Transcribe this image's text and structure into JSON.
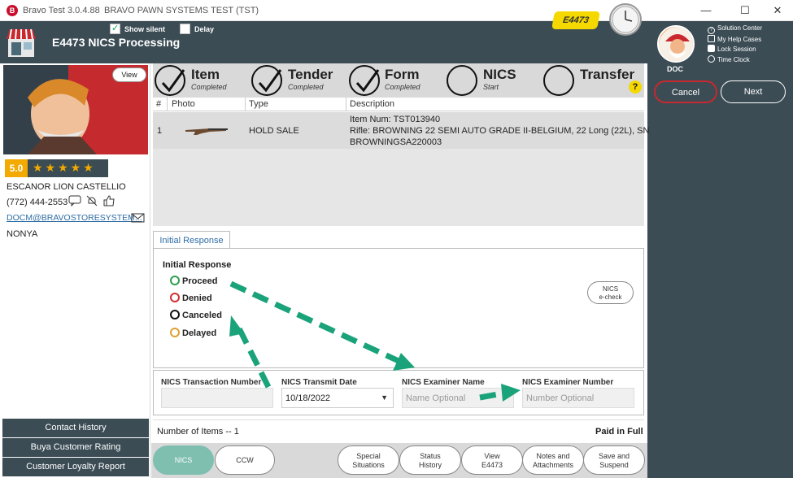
{
  "window": {
    "app_name": "Bravo Test",
    "version": "3.0.4.88",
    "system_name": "BRAVO PAWN SYSTEMS TEST (TST)",
    "minimize": "—",
    "maximize": "☐",
    "close": "✕"
  },
  "header": {
    "title": "E4473 NICS Processing",
    "show_silent_label": "Show silent",
    "show_silent_checked": true,
    "delay_label": "Delay",
    "delay_checked": false,
    "badge": "E4473"
  },
  "user_panel": {
    "name": "DOC",
    "links": [
      "Solution Center",
      "My Help Cases",
      "Lock Session",
      "Time Clock"
    ],
    "cancel_label": "Cancel",
    "next_label": "Next"
  },
  "customer": {
    "view_label": "View",
    "rating": "5.0",
    "stars": "★★★★★",
    "name": "ESCANOR LION CASTELLIO",
    "phone": "(772) 444-2553",
    "email": "DOCM@BRAVOSTORESYSTEM...",
    "note": "NONYA",
    "nav": [
      "Contact History",
      "Buya Customer Rating",
      "Customer Loyalty Report"
    ]
  },
  "steps": [
    {
      "title": "Item",
      "status": "Completed",
      "done": true
    },
    {
      "title": "Tender",
      "status": "Completed",
      "done": true
    },
    {
      "title": "Form",
      "status": "Completed",
      "done": true
    },
    {
      "title": "NICS",
      "status": "Start",
      "done": false
    },
    {
      "title": "Transfer",
      "status": "",
      "done": false
    }
  ],
  "help_icon": "?",
  "table": {
    "columns": [
      "#",
      "Photo",
      "Type",
      "Description"
    ],
    "rows": [
      {
        "num": "1",
        "type": "HOLD SALE",
        "desc_line1": "Item Num: TST013940",
        "desc_line2": "Rifle: BROWNING 22 SEMI AUTO GRADE II-BELGIUM, 22 Long (22L), SN",
        "desc_line3": "BROWNINGSA220003"
      }
    ]
  },
  "tab": {
    "label": "Initial Response"
  },
  "initial_response": {
    "heading": "Initial Response",
    "options": [
      {
        "label": "Proceed",
        "color": "#2e9e4f"
      },
      {
        "label": "Denied",
        "color": "#d32f2f"
      },
      {
        "label": "Canceled",
        "color": "#111111"
      },
      {
        "label": "Delayed",
        "color": "#e0a030"
      }
    ],
    "echeck_line1": "NICS",
    "echeck_line2": "e-check"
  },
  "fields": {
    "transaction_number_label": "NICS Transaction Number",
    "transaction_number_value": "",
    "transmit_date_label": "NICS Transmit Date",
    "transmit_date_value": "10/18/2022",
    "examiner_name_label": "NICS Examiner Name",
    "examiner_name_placeholder": "Name Optional",
    "examiner_number_label": "NICS Examiner Number",
    "examiner_number_placeholder": "Number Optional"
  },
  "summary": {
    "items_count": "Number of Items -- 1",
    "paid_status": "Paid in Full"
  },
  "bottom_buttons": [
    {
      "line1": "NICS",
      "line2": ""
    },
    {
      "line1": "CCW",
      "line2": ""
    },
    {
      "line1": "Special",
      "line2": "Situations"
    },
    {
      "line1": "Status",
      "line2": "History"
    },
    {
      "line1": "View",
      "line2": "E4473"
    },
    {
      "line1": "Notes and",
      "line2": "Attachments"
    },
    {
      "line1": "Save and",
      "line2": "Suspend"
    }
  ],
  "colors": {
    "header_bg": "#3b4c55",
    "accent_yellow": "#f5d800",
    "rating_orange": "#f2a900",
    "link_blue": "#2e6da4",
    "arrow_green": "#1aa37a",
    "nics_active": "#7fbfb0"
  }
}
